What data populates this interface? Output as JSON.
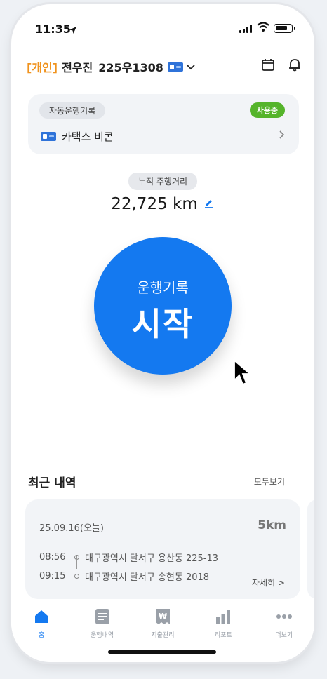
{
  "status": {
    "time": "11:35"
  },
  "header": {
    "tag": "[개인]",
    "name": "전우진",
    "plate": "225우1308"
  },
  "auto_log": {
    "title": "자동운행기록",
    "badge": "사용중",
    "device": "카택스 비콘"
  },
  "mileage": {
    "label": "누적 주행거리",
    "value": "22,725 km"
  },
  "start_button": {
    "sub": "운행기록",
    "main": "시작"
  },
  "recent": {
    "title": "최근 내역",
    "more": "모두보기",
    "trip": {
      "date": "25.09.16(오늘)",
      "distance": "5km",
      "start_time": "08:56",
      "start_addr": "대구광역시 달서구 용산동  225-13",
      "end_time": "09:15",
      "end_addr": "대구광역시 달서구 송현동  2018",
      "detail": "자세히 >"
    }
  },
  "tabs": [
    {
      "label": "홈",
      "icon": "home-icon",
      "active": true
    },
    {
      "label": "운행내역",
      "icon": "list-icon",
      "active": false
    },
    {
      "label": "지출관리",
      "icon": "won-icon",
      "active": false
    },
    {
      "label": "리포트",
      "icon": "chart-icon",
      "active": false
    },
    {
      "label": "더보기",
      "icon": "more-icon",
      "active": false
    }
  ],
  "colors": {
    "accent": "#1479f0",
    "tag": "#f0931e",
    "badge": "#55b42b"
  }
}
